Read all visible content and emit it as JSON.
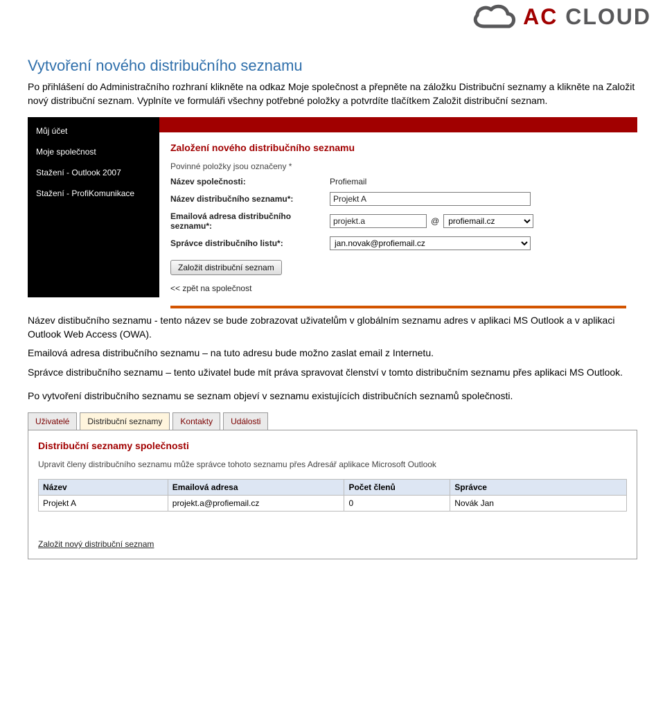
{
  "logo": {
    "ac": "AC",
    "cloud": "CLOUD"
  },
  "doc": {
    "title": "Vytvoření nového distribučního seznamu",
    "intro": "Po přihlášení do Administračního rozhraní klikněte na odkaz  Moje společnost a přepněte na záložku Distribuční seznamy a klikněte na Založit nový distribuční seznam. Vyplníte ve formuláři všechny potřebné položky a potvrdíte tlačítkem Založit distribuční seznam.",
    "after_name": "Název distibučního seznamu -  tento název se bude zobrazovat uživatelům v globálním seznamu adres v aplikaci MS Outlook a v aplikaci Outlook Web Access (OWA).",
    "after_email": "Emailová adresa distribučního seznamu  –  na tuto adresu bude možno zaslat email z Internetu.",
    "after_admin": "Správce distribučního seznamu – tento uživatel  bude mít práva spravovat členství v tomto distribučním seznamu přes aplikaci MS Outlook.",
    "after_result": "Po vytvoření distribučního seznamu se seznam objeví v seznamu existujících distribučních seznamů společnosti."
  },
  "ss1": {
    "sidebar": [
      "Můj účet",
      "Moje společnost",
      "Stažení - Outlook 2007",
      "Stažení - ProfiKomunikace"
    ],
    "panel_title": "Založení nového distribučního seznamu",
    "hint": "Povinné položky jsou označeny *",
    "rows": {
      "company_label": "Název společnosti:",
      "company_value": "Profiemail",
      "dlname_label": "Název distribučního seznamu*:",
      "dlname_value": "Projekt A",
      "email_label": "Emailová adresa distribučního seznamu*:",
      "email_local": "projekt.a",
      "email_at": "@",
      "email_domain": "profiemail.cz",
      "admin_label": "Správce distribučního listu*:",
      "admin_value": "jan.novak@profiemail.cz"
    },
    "submit": "Založit distribuční seznam",
    "back": "<< zpět na společnost"
  },
  "tabs": {
    "users": "Uživatelé",
    "dl": "Distribuční seznamy",
    "contacts": "Kontakty",
    "events": "Události"
  },
  "list": {
    "title": "Distribuční seznamy společnosti",
    "hint": "Upravit členy distribučního seznamu může správce tohoto seznamu přes Adresář aplikace Microsoft Outlook",
    "headers": {
      "name": "Název",
      "email": "Emailová adresa",
      "count": "Počet členů",
      "admin": "Správce"
    },
    "rows": [
      {
        "name": "Projekt A",
        "email": "projekt.a@profiemail.cz",
        "count": "0",
        "admin": "Novák Jan"
      }
    ],
    "create_link": "Založit nový distribuční seznam"
  }
}
